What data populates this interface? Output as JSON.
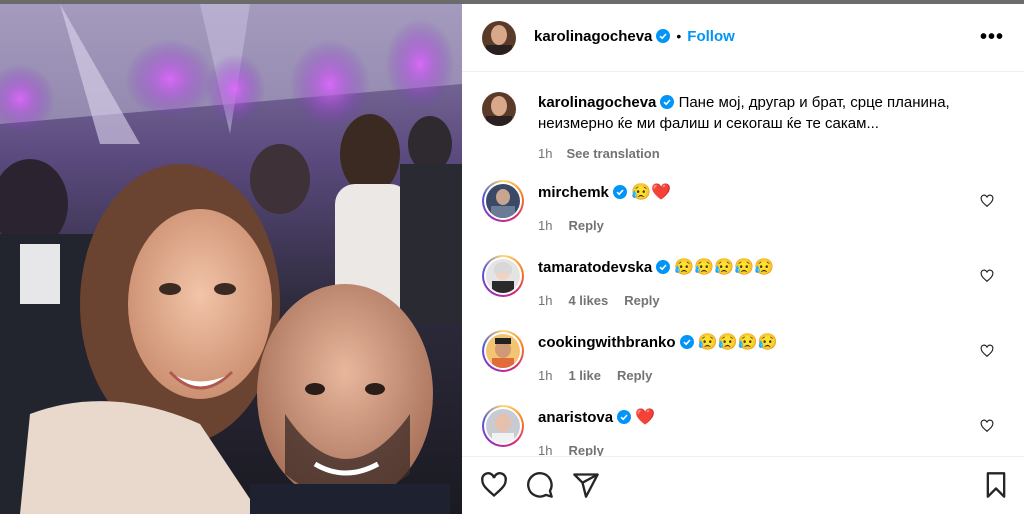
{
  "post": {
    "author": "karolinagocheva",
    "follow_label": "Follow",
    "dot": "•",
    "more_label": "•••",
    "caption_line1": "Пане мој, другар и брат, срце планина,",
    "caption_line2": "неизмерно ќе ми фалиш и секогаш ќе те сакам...",
    "caption_time": "1h",
    "see_translation": "See translation"
  },
  "comments": [
    {
      "user": "mirchemk",
      "text": "😥❤️",
      "time": "1h",
      "likes": "",
      "reply": "Reply",
      "avatar_color": "#3a4a66"
    },
    {
      "user": "tamaratodevska",
      "text": "😥😥😥😥😥",
      "time": "1h",
      "likes": "4 likes",
      "reply": "Reply",
      "avatar_color": "#d9d9d9"
    },
    {
      "user": "cookingwithbranko",
      "text": "😥😥😥😥",
      "time": "1h",
      "likes": "1 like",
      "reply": "Reply",
      "avatar_color": "#e9b86a"
    },
    {
      "user": "anaristova",
      "text": "❤️",
      "time": "1h",
      "likes": "",
      "reply": "Reply",
      "avatar_color": "#c9cbd3"
    }
  ],
  "colors": {
    "accent": "#0095f6",
    "verified": "#0095f6",
    "muted": "#737373",
    "heart_red": "#e0245e"
  },
  "icons": [
    "like-icon",
    "comment-icon",
    "share-icon",
    "save-icon",
    "verified-icon",
    "heart-outline-icon",
    "more-icon"
  ]
}
